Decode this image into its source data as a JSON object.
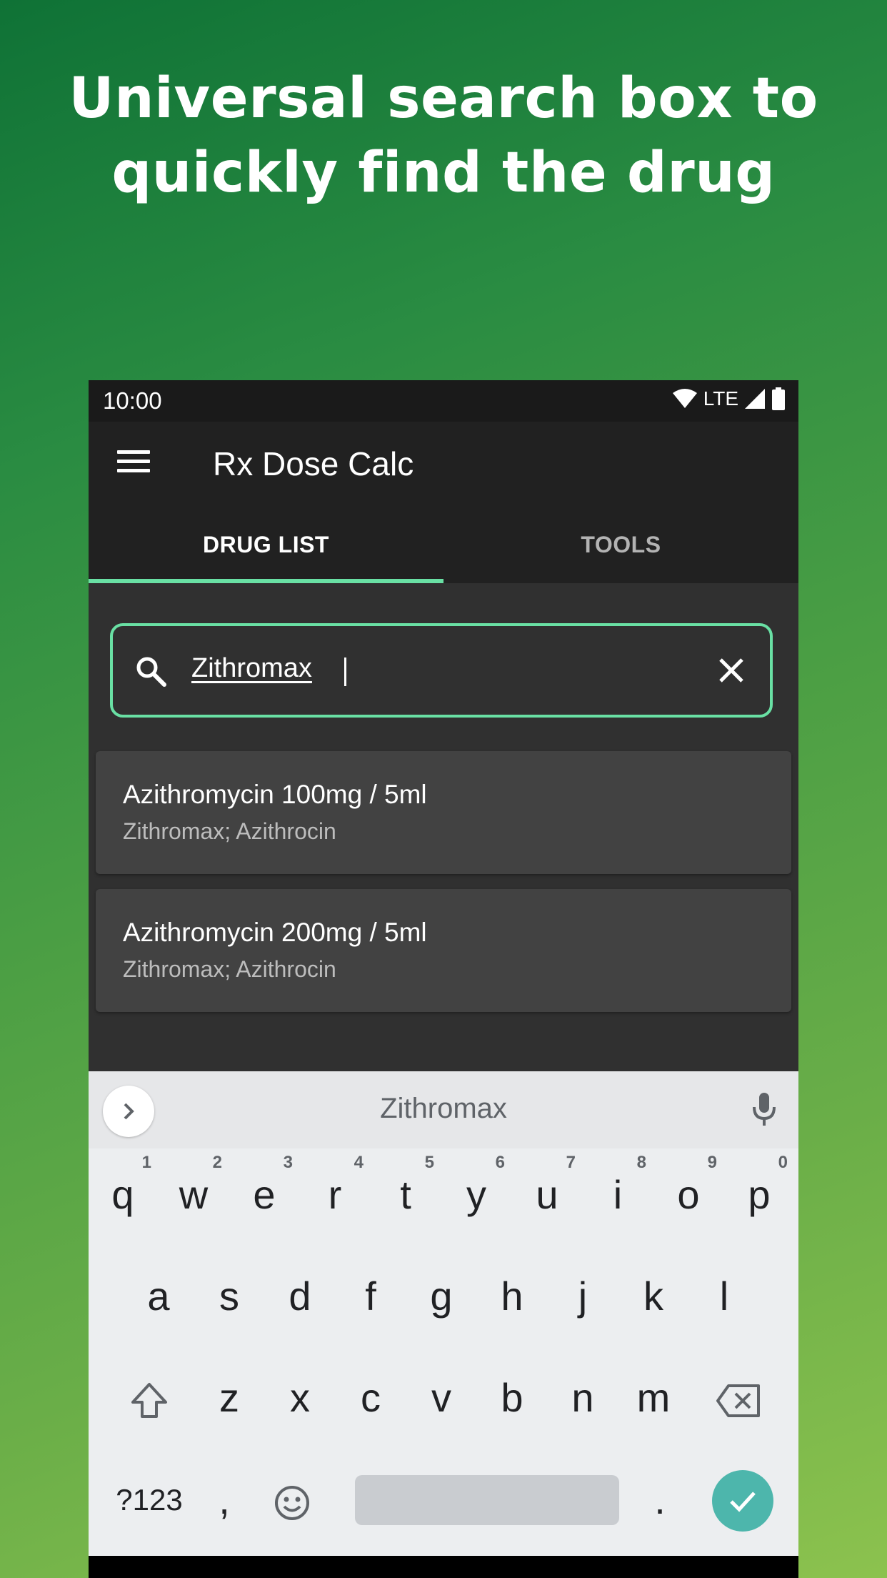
{
  "headline": {
    "line1": "Universal search box to",
    "line2": "quickly find the drug"
  },
  "status_bar": {
    "time": "10:00",
    "network": "LTE"
  },
  "app_bar": {
    "title": "Rx Dose Calc"
  },
  "tabs": [
    {
      "label": "DRUG LIST"
    },
    {
      "label": "TOOLS"
    }
  ],
  "search": {
    "value": "Zithromax"
  },
  "results": [
    {
      "title": "Azithromycin 100mg / 5ml",
      "subtitle": "Zithromax; Azithrocin"
    },
    {
      "title": "Azithromycin 200mg / 5ml",
      "subtitle": "Zithromax; Azithrocin"
    }
  ],
  "keyboard": {
    "suggestion": "Zithromax",
    "row1": [
      {
        "k": "q",
        "n": "1"
      },
      {
        "k": "w",
        "n": "2"
      },
      {
        "k": "e",
        "n": "3"
      },
      {
        "k": "r",
        "n": "4"
      },
      {
        "k": "t",
        "n": "5"
      },
      {
        "k": "y",
        "n": "6"
      },
      {
        "k": "u",
        "n": "7"
      },
      {
        "k": "i",
        "n": "8"
      },
      {
        "k": "o",
        "n": "9"
      },
      {
        "k": "p",
        "n": "0"
      }
    ],
    "row2": [
      "a",
      "s",
      "d",
      "f",
      "g",
      "h",
      "j",
      "k",
      "l"
    ],
    "row3": [
      "z",
      "x",
      "c",
      "v",
      "b",
      "n",
      "m"
    ],
    "symbols_label": "?123",
    "comma": ",",
    "period": "."
  },
  "colors": {
    "accent": "#69e0a4",
    "enter_key": "#4db6ac",
    "app_bar": "#212121",
    "content_bg": "#303030",
    "card_bg": "#424242"
  }
}
